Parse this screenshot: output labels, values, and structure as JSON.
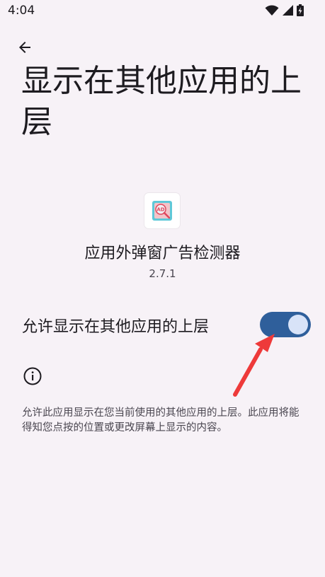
{
  "status_bar": {
    "time": "4:04",
    "icons": [
      "wifi-icon",
      "signal-icon",
      "battery-charging-icon"
    ]
  },
  "header": {
    "back_icon": "arrow-left-icon",
    "title": "显示在其他应用的上层"
  },
  "app": {
    "name": "应用外弹窗广告检测器",
    "version": "2.7.1",
    "icon": "ad-magnifier-icon"
  },
  "permission": {
    "label": "允许显示在其他应用的上层",
    "enabled": true
  },
  "info": {
    "icon": "info-icon",
    "description": "允许此应用显示在您当前使用的其他应用的上层。此应用将能得知您点按的位置或更改屏幕上显示的内容。"
  },
  "colors": {
    "background": "#f7f2f7",
    "toggle_track": "#2f5f9b",
    "toggle_thumb": "#d8e3f8",
    "annotation_arrow": "#ee3a3a"
  }
}
